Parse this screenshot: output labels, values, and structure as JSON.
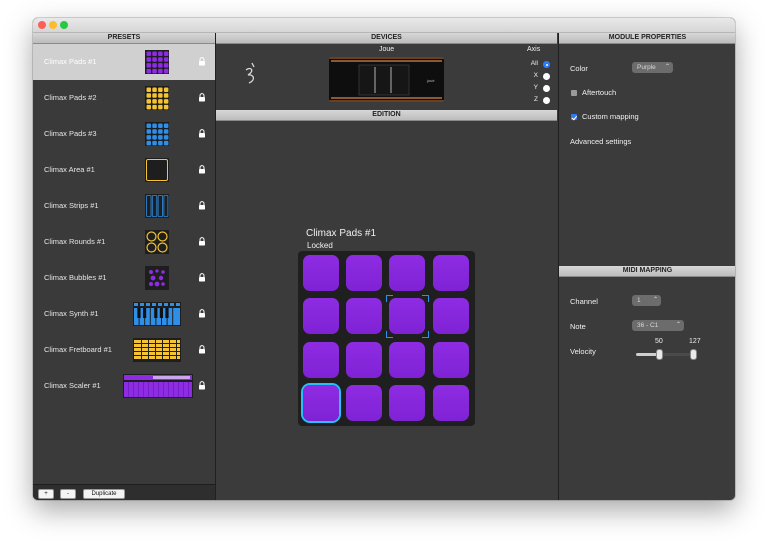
{
  "window": {
    "title": ""
  },
  "presets": {
    "header": "PRESETS",
    "items": [
      {
        "label": "Climax  Pads #1",
        "thumb": "pads-purple-thumb",
        "selected": true
      },
      {
        "label": "Climax Pads #2",
        "thumb": "pads-yellow-thumb"
      },
      {
        "label": "Climax Pads #3",
        "thumb": "pads-blue-thumb"
      },
      {
        "label": "Climax Area #1",
        "thumb": "area-thumb"
      },
      {
        "label": "Climax Strips #1",
        "thumb": "strips-thumb"
      },
      {
        "label": "Climax Rounds #1",
        "thumb": "rounds-thumb"
      },
      {
        "label": "Climax Bubbles #1",
        "thumb": "bubbles-thumb"
      },
      {
        "label": "Climax Synth #1",
        "thumb": "synth-keyboard-thumb"
      },
      {
        "label": "Climax Fretboard #1",
        "thumb": "fretboard-thumb"
      },
      {
        "label": "Climax Scaler #1",
        "thumb": "scaler-thumb"
      }
    ],
    "footer": {
      "add_label": "+",
      "remove_label": "-",
      "duplicate_label": "Duplicate"
    }
  },
  "devices": {
    "header": "DEVICES",
    "device_name": "Joue",
    "axis": {
      "title": "Axis",
      "options": [
        {
          "label": "All",
          "selected": true
        },
        {
          "label": "X",
          "selected": false
        },
        {
          "label": "Y",
          "selected": false
        },
        {
          "label": "Z",
          "selected": false
        }
      ]
    }
  },
  "edition": {
    "header": "EDITION",
    "preset_title": "Climax  Pads #1",
    "preset_status": "Locked",
    "pads": {
      "rows": 4,
      "cols": 4,
      "color": "#8a2be2",
      "selected_index": 12,
      "focused_index": 6
    }
  },
  "module_properties": {
    "header": "MODULE PROPERTIES",
    "color_label": "Color",
    "color_value": "Purple",
    "aftertouch_label": "Aftertouch",
    "aftertouch_checked": false,
    "custom_mapping_label": "Custom mapping",
    "custom_mapping_checked": true,
    "advanced_settings_label": "Advanced settings"
  },
  "midi_mapping": {
    "header": "MIDI MAPPING",
    "channel_label": "Channel",
    "channel_value": "1",
    "note_label": "Note",
    "note_value": "36 - C1",
    "velocity_label": "Velocity",
    "velocity_min": "50",
    "velocity_max": "127",
    "velocity_range_fraction": [
      0.39,
      1.0
    ]
  },
  "colors": {
    "accent": "#2d7cf6",
    "pad": "#8a2be2",
    "selection": "#26c0ff"
  }
}
